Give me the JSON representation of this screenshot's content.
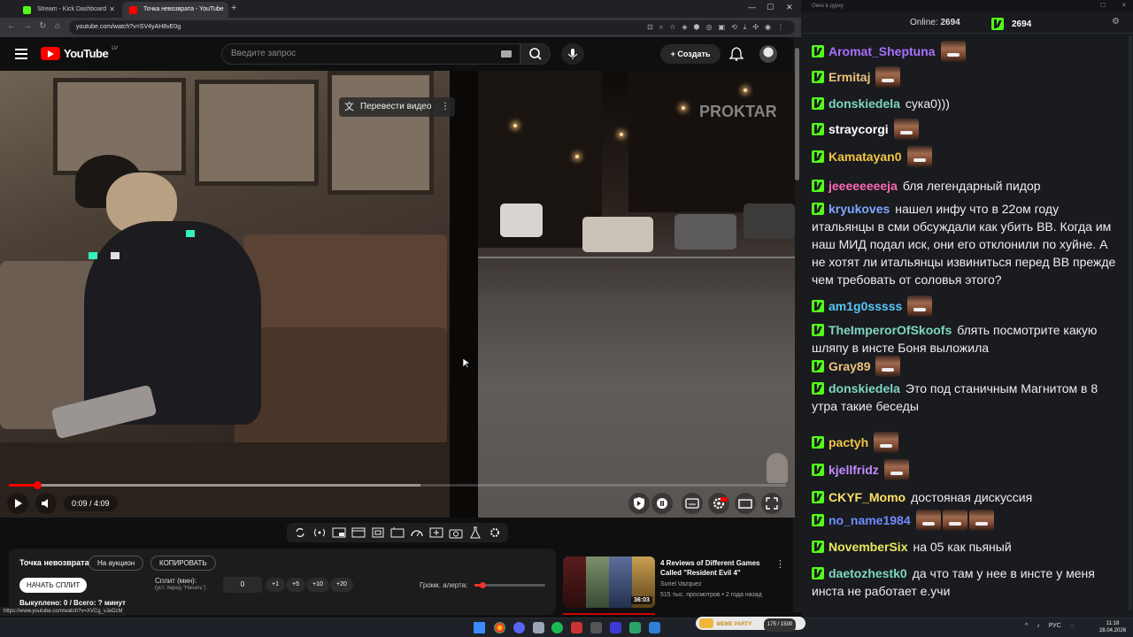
{
  "browser": {
    "tabs": [
      {
        "title": "Stream - Kick Dashboard",
        "fav_color": "#53fc18"
      },
      {
        "title": "Точка невозврата - YouTube",
        "fav_color": "#ff0000"
      }
    ],
    "url": "youtube.com/watch?v=SV4yAH8vE0g"
  },
  "youtube": {
    "logo": "YouTube",
    "country_code": "LV",
    "search_placeholder": "Введите запрос",
    "create_label": "Создать"
  },
  "video": {
    "watermark": "PROKTAR",
    "translate_label": "Перевести видео",
    "time": "0:09 / 4:09",
    "played_fraction": 0.036,
    "buffered_fraction": 0.53
  },
  "auction": {
    "title": "Точка невозврата",
    "auction_btn": "На аукцион",
    "copy_btn": "КОПИРОВАТЬ",
    "start_btn": "НАЧАТЬ СПЛИТ",
    "split_label": "Сплит (мин):",
    "split_sub": "(уст. перед \"Начать\")",
    "split_value": "0",
    "increments": [
      "+1",
      "+5",
      "+10",
      "+20"
    ],
    "volume_label": "Громк. алерта:",
    "volume_level": 0.1,
    "bought": "Выкуплено: 0 / Всего: ? минут"
  },
  "status_url": "https://www.youtube.com/watch?v=XVCg_vJeDzM",
  "recommended": {
    "title": "4 Reviews of Different Games Called \"Resident Evil 4\"",
    "channel": "Suriel Vazquez",
    "meta": "515 тыс. просмотров • 2 года назад",
    "duration": "36:03"
  },
  "chat": {
    "window_title": "Окно в дурку",
    "online_label": "Online:",
    "online_count": "2694",
    "viewer_count": "2694",
    "messages": [
      {
        "user": "Aromat_Sheptuna",
        "color": "#a970ff",
        "text": "",
        "emotes": 1
      },
      {
        "user": "Ermitaj",
        "color": "#f0c27b",
        "text": "",
        "emotes": 1
      },
      {
        "user": "donskiedela",
        "color": "#7fd6c2",
        "text": "сука0)))",
        "emotes": 0
      },
      {
        "user": "straycorgi",
        "color": "#ffffff",
        "text": "",
        "emotes": 1
      },
      {
        "user": "Kamatayan0",
        "color": "#f5c542",
        "text": "",
        "emotes": 1
      },
      {
        "user": "jeeeeeeeeja",
        "color": "#ff69b4",
        "text": "бля легендарный пидор",
        "emotes": 0
      },
      {
        "user": "kryukoves",
        "color": "#7fa8ff",
        "text": "нашел инфу что в 22ом году итальянцы в сми обсуждали как убить ВВ. Когда им наш МИД подал иск, они его отклонили по хуйне. А не хотят ли итальянцы извиниться перед ВВ прежде чем требовать от соловья этого?",
        "emotes": 0
      },
      {
        "user": "am1g0sssss",
        "color": "#5ac8fa",
        "text": "",
        "emotes": 1
      },
      {
        "user": "TheImperorOfSkoofs",
        "color": "#7fd6c2",
        "text": "блять посмотрите какую шляпу в инсте Боня выложила",
        "emotes": 0
      },
      {
        "user": "Gray89",
        "color": "#f0c27b",
        "text": "",
        "emotes": 1
      },
      {
        "user": "donskiedela",
        "color": "#7fd6c2",
        "text": "Это под станичным Магнитом в 8 утра такие беседы",
        "emotes": 0
      },
      {
        "user": "pactyh",
        "color": "#f5c542",
        "text": "",
        "emotes": 1
      },
      {
        "user": "kjellfridz",
        "color": "#c38aff",
        "text": "",
        "emotes": 1
      },
      {
        "user": "CKYF_Momo",
        "color": "#ffe066",
        "text": "достояная дискуссия",
        "emotes": 0
      },
      {
        "user": "no_name1984",
        "color": "#6f8cff",
        "text": "",
        "emotes": 3
      },
      {
        "user": "NovemberSix",
        "color": "#e8e85a",
        "text": "на 05 как пьяный",
        "emotes": 0
      },
      {
        "user": "daetozhestk0",
        "color": "#7fd6c2",
        "text": "да что там у нее в инсте у меня инста не работает е.учи",
        "emotes": 0
      }
    ]
  },
  "taskbar": {
    "media_label": "MEME PARTY",
    "media_counter": "175 / 1500",
    "lang": "РУС",
    "time": "11:18",
    "date": "28.04.2026"
  }
}
